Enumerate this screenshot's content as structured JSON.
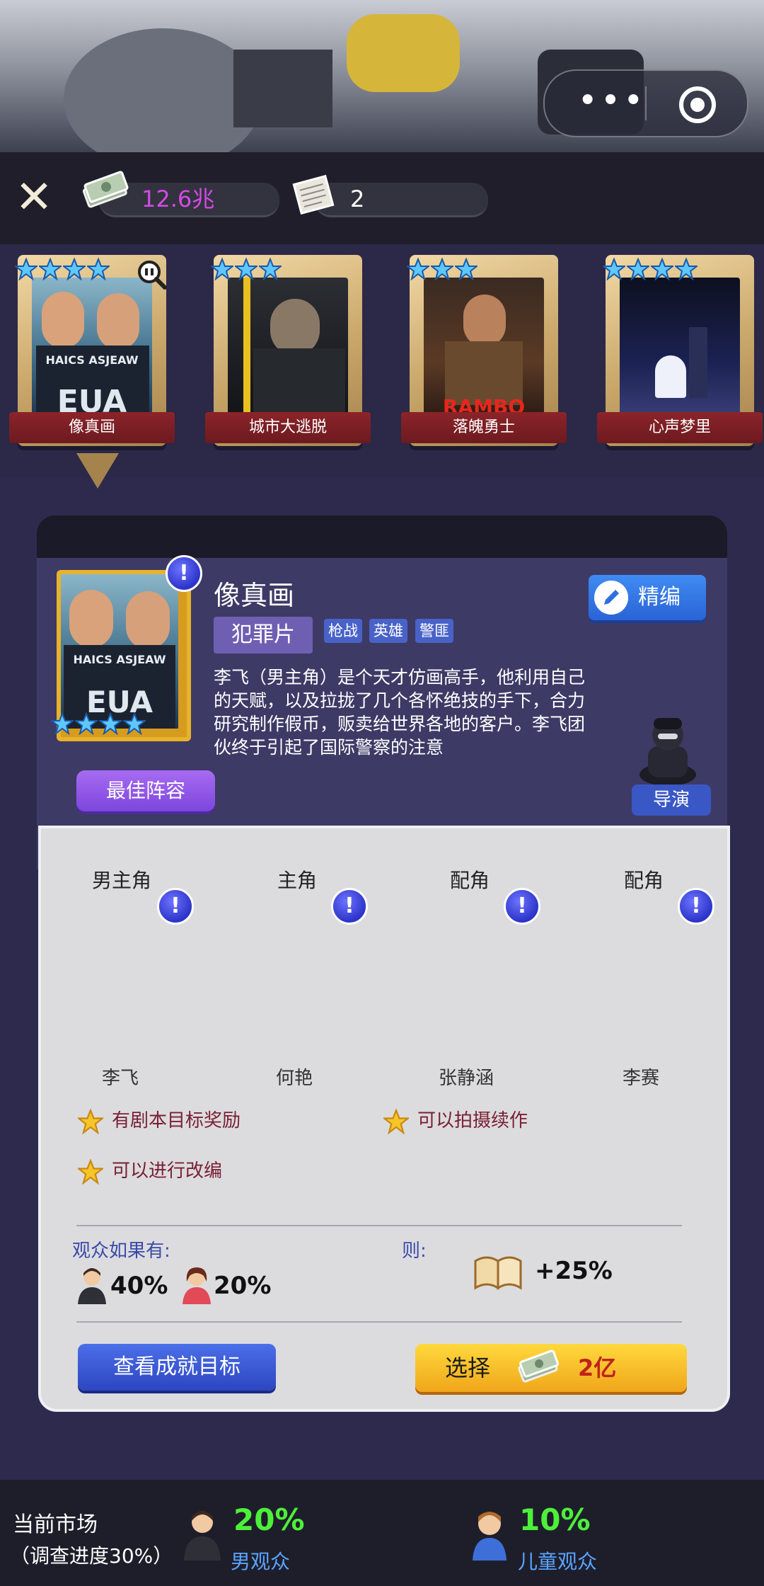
{
  "header": {
    "capsule_more": "•••"
  },
  "resources": {
    "money": "12.6兆",
    "scripts": "2"
  },
  "movies": [
    {
      "title": "像真画",
      "stars": 4,
      "poster_text": "HAICS ASJEAW",
      "poster_logo": "EUA"
    },
    {
      "title": "城市大逃脱",
      "stars": 3
    },
    {
      "title": "落魄勇士",
      "stars": 3,
      "poster_logo": "RAMBO"
    },
    {
      "title": "心声梦里",
      "stars": 4
    }
  ],
  "detail": {
    "title": "像真画",
    "genre": "犯罪片",
    "tags": [
      "枪战",
      "英雄",
      "警匪"
    ],
    "edit_label": "精编",
    "description": "李飞（男主角）是个天才仿画高手，他利用自己的天赋，以及拉拢了几个各怀绝技的手下，合力研究制作假币，贩卖给世界各地的客户。李飞团伙终于引起了国际警察的注意",
    "best_cast_label": "最佳阵容",
    "director_label": "导演",
    "poster_text": "HAICS ASJEAW",
    "poster_logo": "EUA",
    "roles": [
      {
        "role": "男主角",
        "actor": "李飞"
      },
      {
        "role": "主角",
        "actor": "何艳"
      },
      {
        "role": "配角",
        "actor": "张静涵"
      },
      {
        "role": "配角",
        "actor": "李赛"
      }
    ],
    "bonuses": [
      "有剧本目标奖励",
      "可以拍摄续作",
      "可以进行改编"
    ],
    "audience_label": "观众如果有:",
    "then_label": "则:",
    "audience": [
      {
        "gender": "male",
        "pct": "40%"
      },
      {
        "gender": "female",
        "pct": "20%"
      }
    ],
    "bonus_pct": "+25%",
    "view_goals_label": "查看成就目标",
    "choose_label": "选择",
    "price": "2亿"
  },
  "market": {
    "title": "当前市场",
    "progress": "（调查进度30%）",
    "items": [
      {
        "pct": "20%",
        "label": "男观众"
      },
      {
        "pct": "10%",
        "label": "儿童观众"
      }
    ]
  },
  "colors": {
    "money_text": "#d14be3",
    "market_pct": "#4df039",
    "market_label": "#5aa4ff",
    "bonus_text": "#7a2032"
  }
}
